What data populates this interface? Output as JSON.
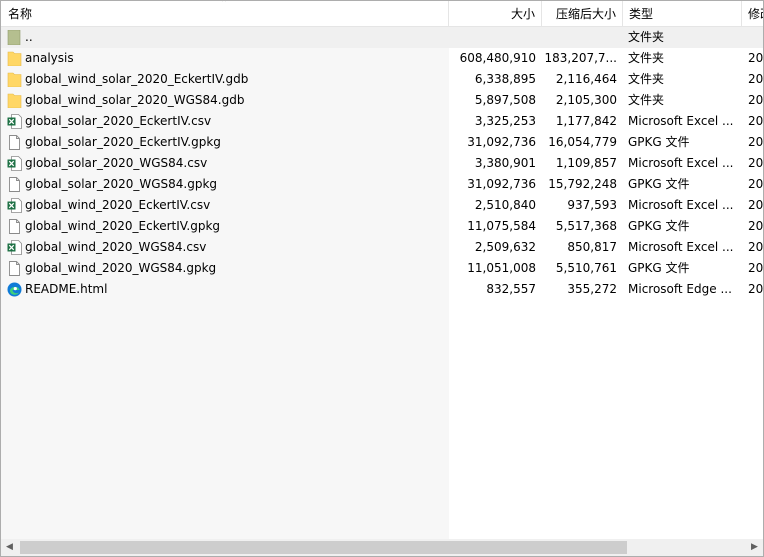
{
  "header": {
    "name": "名称",
    "size": "大小",
    "packed": "压缩后大小",
    "type": "类型",
    "modified": "修改"
  },
  "files": [
    {
      "name": "..",
      "size": "",
      "packed": "",
      "type": "文件夹",
      "modified": "",
      "icon": "parent-folder-icon"
    },
    {
      "name": "analysis",
      "size": "608,480,910",
      "packed": "183,207,7...",
      "type": "文件夹",
      "modified": "20",
      "icon": "folder-icon"
    },
    {
      "name": "global_wind_solar_2020_EckertIV.gdb",
      "size": "6,338,895",
      "packed": "2,116,464",
      "type": "文件夹",
      "modified": "20",
      "icon": "folder-icon"
    },
    {
      "name": "global_wind_solar_2020_WGS84.gdb",
      "size": "5,897,508",
      "packed": "2,105,300",
      "type": "文件夹",
      "modified": "20",
      "icon": "folder-icon"
    },
    {
      "name": "global_solar_2020_EckertIV.csv",
      "size": "3,325,253",
      "packed": "1,177,842",
      "type": "Microsoft Excel ...",
      "modified": "20",
      "icon": "excel-icon"
    },
    {
      "name": "global_solar_2020_EckertIV.gpkg",
      "size": "31,092,736",
      "packed": "16,054,779",
      "type": "GPKG 文件",
      "modified": "20",
      "icon": "file-icon"
    },
    {
      "name": "global_solar_2020_WGS84.csv",
      "size": "3,380,901",
      "packed": "1,109,857",
      "type": "Microsoft Excel ...",
      "modified": "20",
      "icon": "excel-icon"
    },
    {
      "name": "global_solar_2020_WGS84.gpkg",
      "size": "31,092,736",
      "packed": "15,792,248",
      "type": "GPKG 文件",
      "modified": "20",
      "icon": "file-icon"
    },
    {
      "name": "global_wind_2020_EckertIV.csv",
      "size": "2,510,840",
      "packed": "937,593",
      "type": "Microsoft Excel ...",
      "modified": "20",
      "icon": "excel-icon"
    },
    {
      "name": "global_wind_2020_EckertIV.gpkg",
      "size": "11,075,584",
      "packed": "5,517,368",
      "type": "GPKG 文件",
      "modified": "20",
      "icon": "file-icon"
    },
    {
      "name": "global_wind_2020_WGS84.csv",
      "size": "2,509,632",
      "packed": "850,817",
      "type": "Microsoft Excel ...",
      "modified": "20",
      "icon": "excel-icon"
    },
    {
      "name": "global_wind_2020_WGS84.gpkg",
      "size": "11,051,008",
      "packed": "5,510,761",
      "type": "GPKG 文件",
      "modified": "20",
      "icon": "file-icon"
    },
    {
      "name": "README.html",
      "size": "832,557",
      "packed": "355,272",
      "type": "Microsoft Edge ...",
      "modified": "20",
      "icon": "edge-icon"
    }
  ],
  "colors": {
    "folder": "#ffd766",
    "excel": "#1e7145",
    "edge": "#0f7bd8"
  }
}
